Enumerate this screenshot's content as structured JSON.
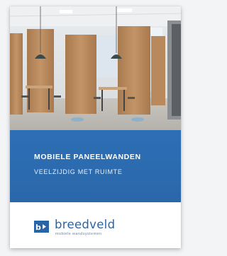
{
  "brochure": {
    "title": "MOBIELE PANEELWANDEN",
    "subtitle": "VEELZIJDIG MET RUIMTE"
  },
  "logo": {
    "name": "breedveld",
    "tagline": "mobiele wandsystemen"
  },
  "colors": {
    "brand_blue": "#2b6aae",
    "wood": "#b98a5e",
    "background": "#f3f4f6"
  }
}
